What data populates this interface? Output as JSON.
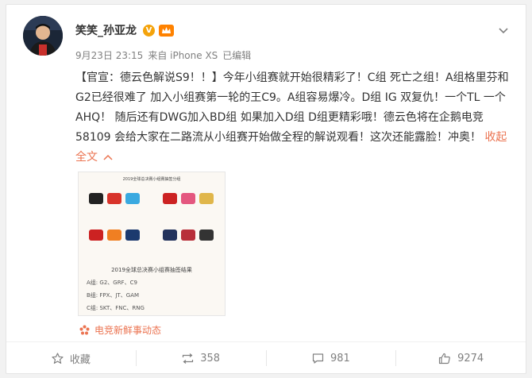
{
  "colors": {
    "accent": "#eb7350",
    "meta": "#808080",
    "text": "#333333"
  },
  "user": {
    "name": "笑笑_孙亚龙",
    "verified_badge": "V"
  },
  "meta": {
    "date": "9月23日 23:15",
    "source": "来自 iPhone XS",
    "edited": "已编辑"
  },
  "post": {
    "text": "【官宣：德云色解说S9！！】今年小组赛就开始很精彩了！C组 死亡之组！A组格里芬和G2已经很难了 加入小组赛第一轮的王C9。A组容易爆冷。D组 IG 双复仇！一个TL 一个AHQ！ 随后还有DWG加入BD组 如果加入D组 D组更精彩哦！德云色将在企鹅电竞58109 会给大家在二路流从小组赛开始做全程的解说观看！这次还能露脸！冲奥！",
    "collapse": "收起全文",
    "collapse_icon": "chevron-up-icon"
  },
  "image": {
    "title": "2019全球总决赛小组赛抽签分组",
    "caption": "2019全球总决赛小组赛抽签结果",
    "groups": [
      {
        "label": "A组:",
        "teams": "G2、GRF、C9"
      },
      {
        "label": "B组:",
        "teams": "FPX、JT、GAM"
      },
      {
        "label": "C组:",
        "teams": "SKT、FNC、RNG"
      }
    ]
  },
  "source_link": {
    "label": "电竞新鲜事动态",
    "icon": "source-flower-icon"
  },
  "actions": [
    {
      "key": "collect",
      "label": "收藏",
      "icon": "star-icon"
    },
    {
      "key": "repost",
      "label": "358",
      "icon": "repost-icon"
    },
    {
      "key": "comment",
      "label": "981",
      "icon": "comment-icon"
    },
    {
      "key": "like",
      "label": "9274",
      "icon": "thumbs-up-icon"
    }
  ]
}
